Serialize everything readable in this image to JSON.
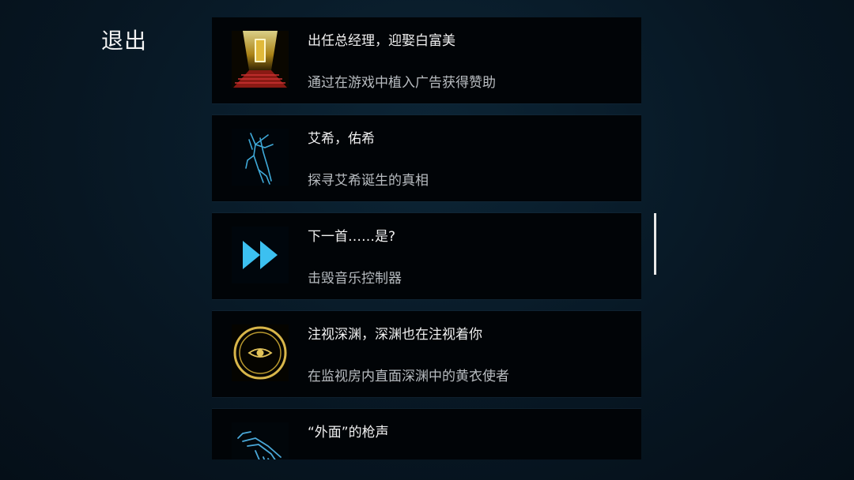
{
  "exit_label": "退出",
  "achievements": [
    {
      "icon": "red-carpet-door-icon",
      "title": "出任总经理，迎娶白富美",
      "desc": "通过在游戏中植入广告获得赞助"
    },
    {
      "icon": "winged-figure-icon",
      "title": "艾希，佑希",
      "desc": "探寻艾希诞生的真相"
    },
    {
      "icon": "fast-forward-icon",
      "title": "下一首……是?",
      "desc": "击毁音乐控制器"
    },
    {
      "icon": "eye-sigil-icon",
      "title": "注视深渊，深渊也在注视着你",
      "desc": "在监视房内直面深渊中的黄衣使者"
    },
    {
      "icon": "gun-icon",
      "title": "“外面”的枪声",
      "desc": ""
    }
  ],
  "colors": {
    "background": "#081a26",
    "card": "#010407",
    "accent_cyan": "#4fc3f7",
    "accent_gold": "#d4b14a"
  }
}
